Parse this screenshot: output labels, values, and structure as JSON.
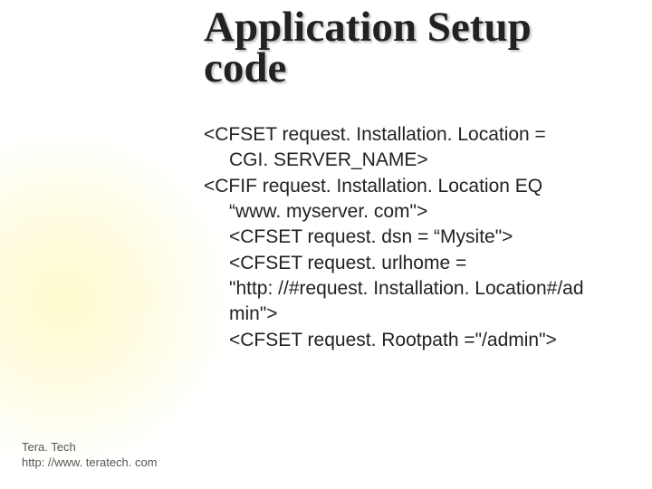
{
  "title": "Application Setup code",
  "code": {
    "l1": "<CFSET request. Installation. Location =",
    "l2": "CGI. SERVER_NAME>",
    "l3": "<CFIF request. Installation. Location EQ",
    "l4": "“www. myserver. com\">",
    "l5": "<CFSET request. dsn = “Mysite\">",
    "l6": "<CFSET request. urlhome =",
    "l7": "\"http: //#request. Installation. Location#/ad",
    "l8": "min\">",
    "l9": "<CFSET request. Rootpath =\"/admin\">"
  },
  "footer": {
    "brand": "Tera. Tech",
    "url": "http: //www. teratech. com"
  }
}
